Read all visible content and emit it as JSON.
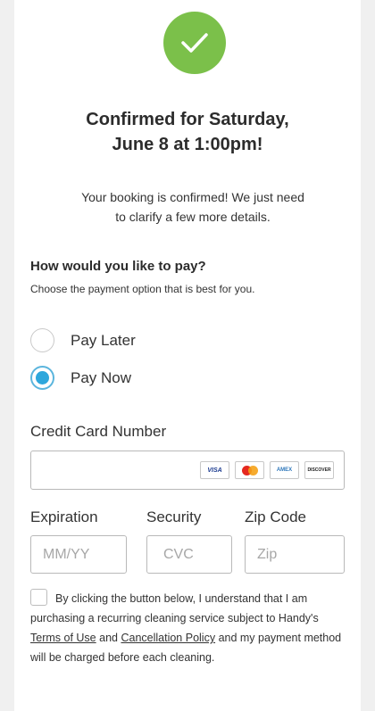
{
  "confirmation": {
    "title_line1": "Confirmed for Saturday,",
    "title_line2": "June 8 at 1:00pm!",
    "message_line1": "Your booking is confirmed! We just need",
    "message_line2": "to clarify a few more details.",
    "accent_color": "#7bc04a",
    "icon": "checkmark-icon"
  },
  "payment": {
    "heading": "How would you like to pay?",
    "subheading": "Choose the payment option that is best for you.",
    "options": [
      {
        "label": "Pay Later",
        "selected": false
      },
      {
        "label": "Pay Now",
        "selected": true
      }
    ],
    "selected_color": "#2ea7dc"
  },
  "card_form": {
    "card_number_label": "Credit Card Number",
    "card_number_value": "",
    "card_brands": [
      "VISA",
      "MasterCard",
      "AMEX",
      "DISCOVER"
    ],
    "expiration_label": "Expiration",
    "expiration_placeholder": "MM/YY",
    "security_label": "Security",
    "security_placeholder": "CVC",
    "zip_label": "Zip Code",
    "zip_placeholder": "Zip"
  },
  "terms": {
    "checked": false,
    "text_part1": "By clicking the button below, I understand that I am purchasing a recurring cleaning service subject to Handy's",
    "terms_link": "Terms of Use",
    "and_text": "and",
    "cancellation_link": "Cancellation Policy",
    "text_part2": "and my payment method will be charged before each cleaning."
  }
}
